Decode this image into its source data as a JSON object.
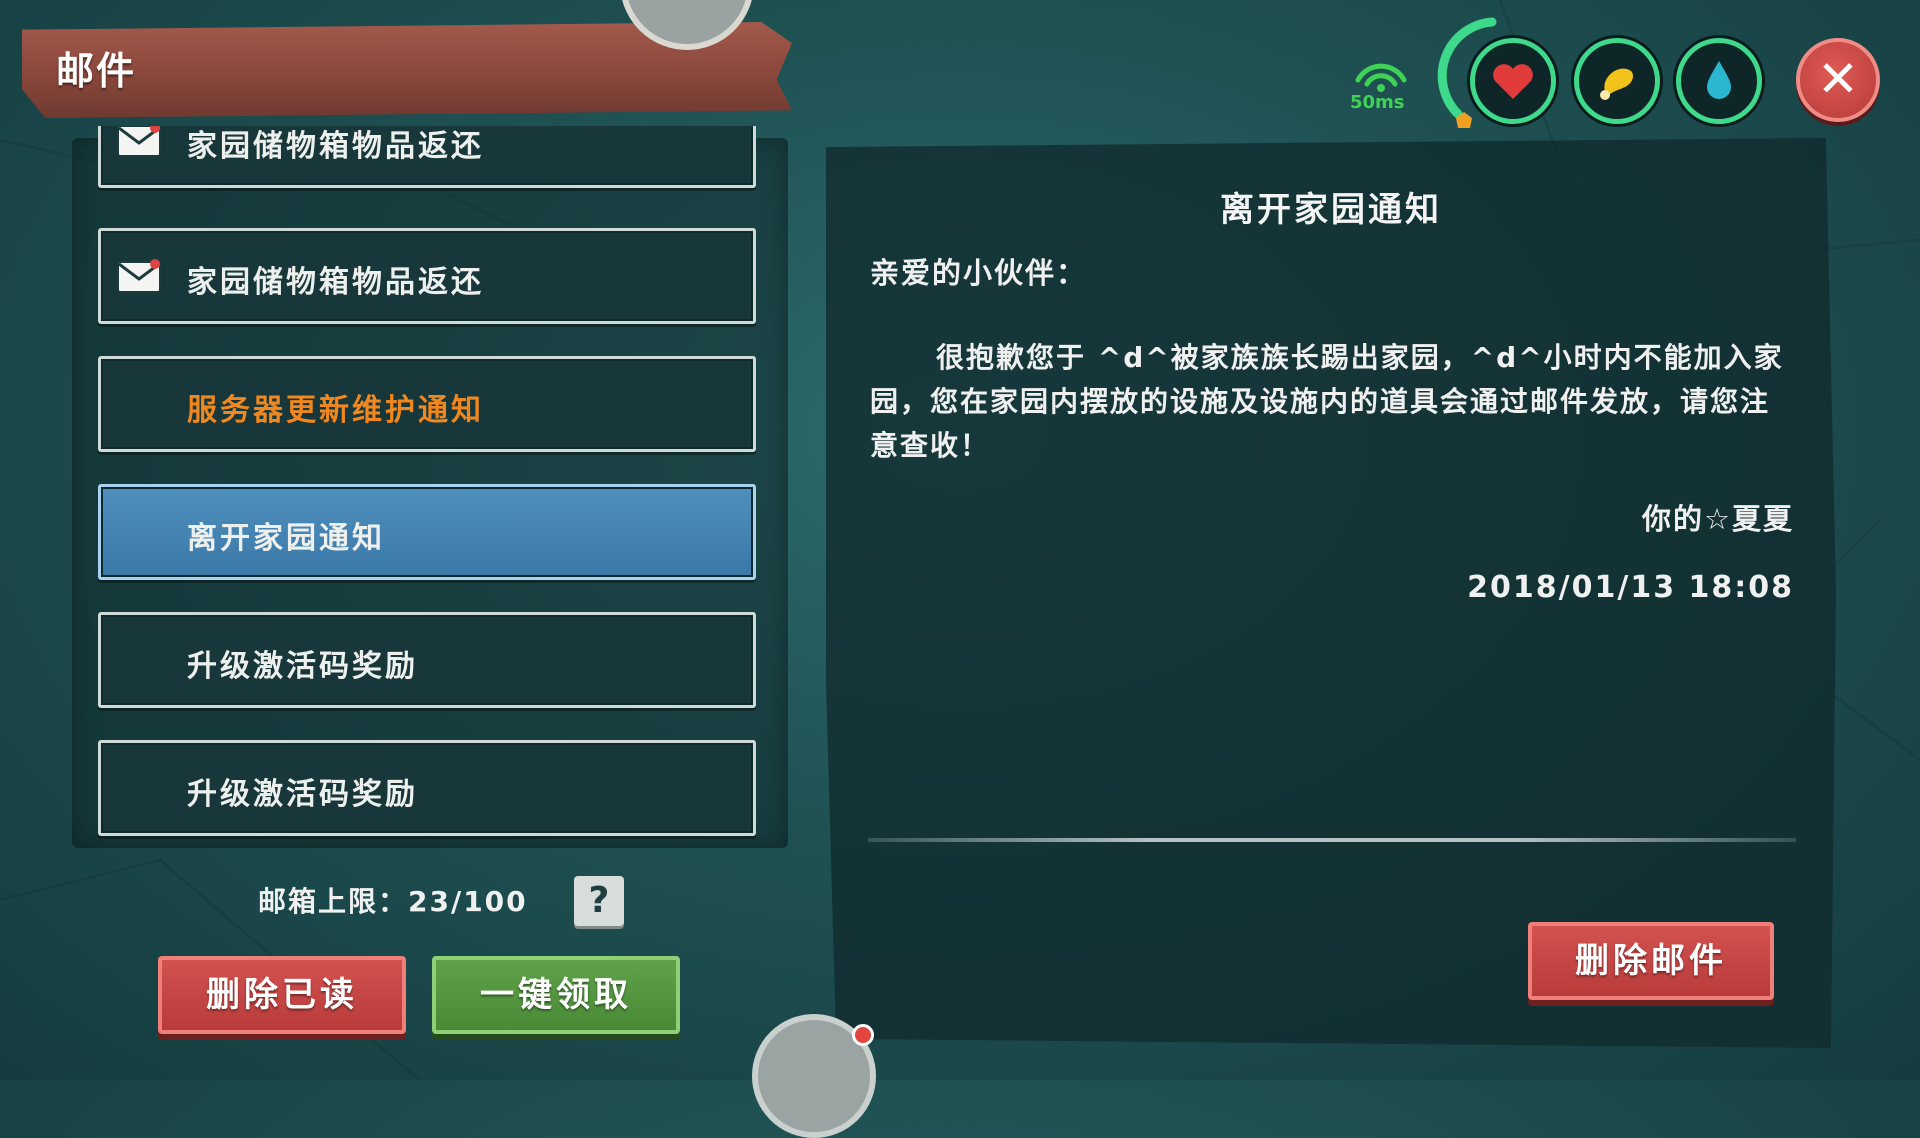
{
  "header": {
    "title": "邮件"
  },
  "hud": {
    "ping": "50ms",
    "icons": [
      "heart-icon",
      "drumstick-icon",
      "water-drop-icon"
    ],
    "colors": {
      "ping": "#40d257",
      "ring": "#3ed98b",
      "heart": "#e23b3b",
      "food": "#f1c21a",
      "water": "#2ab7cf"
    }
  },
  "mail_list": {
    "items": [
      {
        "label": "家园储物箱物品返还",
        "icon": "envelope-icon",
        "state": "normal"
      },
      {
        "label": "家园储物箱物品返还",
        "icon": "envelope-icon",
        "state": "normal"
      },
      {
        "label": "服务器更新维护通知",
        "icon": "",
        "state": "important"
      },
      {
        "label": "离开家园通知",
        "icon": "",
        "state": "selected"
      },
      {
        "label": "升级激活码奖励",
        "icon": "",
        "state": "normal"
      },
      {
        "label": "升级激活码奖励",
        "icon": "",
        "state": "normal"
      }
    ],
    "mailbox_limit": "邮箱上限：23/100",
    "help_label": "?",
    "delete_read_label": "删除已读",
    "claim_all_label": "一键领取"
  },
  "detail": {
    "title": "离开家园通知",
    "greeting": "亲爱的小伙伴：",
    "body": "很抱歉您于 ^d^被家族族长踢出家园，^d^小时内不能加入家园，您在家园内摆放的设施及设施内的道具会通过邮件发放，请您注意查收！",
    "signature": "你的☆夏夏",
    "datetime": "2018/01/13 18:08",
    "delete_label": "删除邮件"
  },
  "accents": {
    "orange": "#f0871f",
    "selected_blue": "#3f80b0",
    "red_button": "#c4423f",
    "green_button": "#52963f"
  }
}
